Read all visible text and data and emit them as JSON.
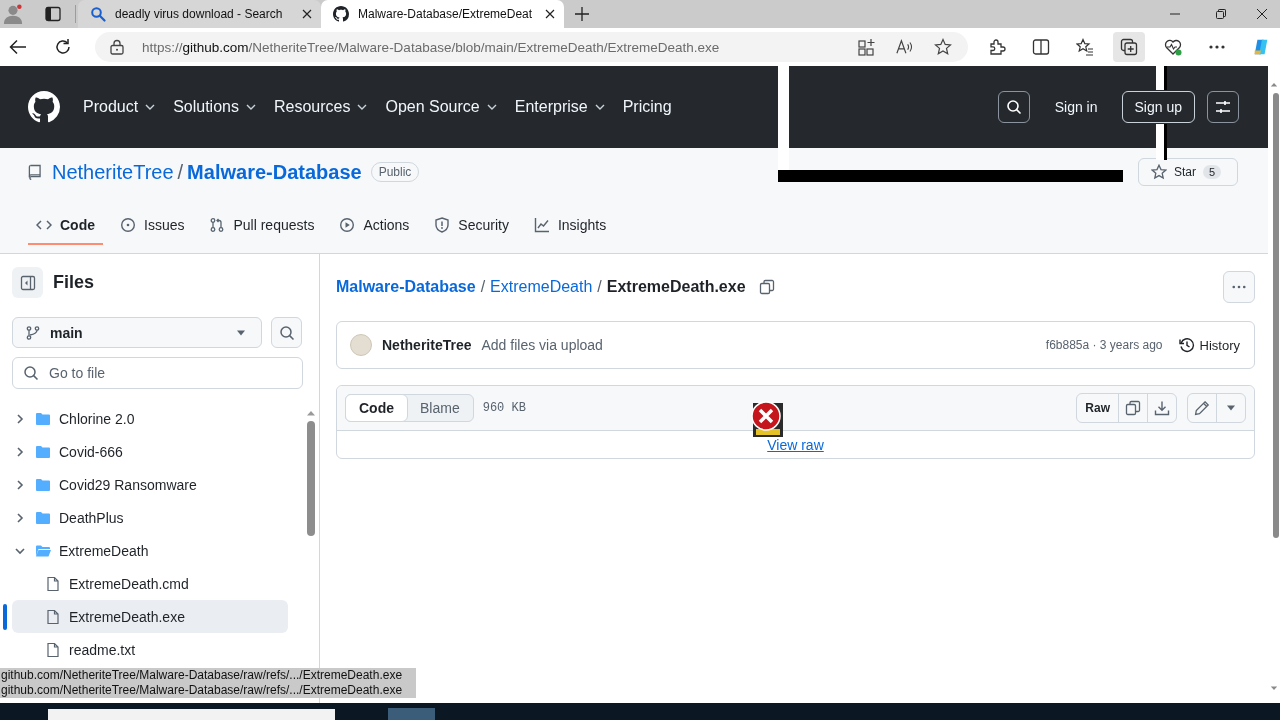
{
  "browser": {
    "tabs": [
      {
        "kind": "search",
        "title": "deadly virus download - Search",
        "selected": false
      },
      {
        "kind": "github",
        "title": "Malware-Database/ExtremeDeat",
        "selected": true
      }
    ],
    "address": {
      "scheme": "https://",
      "host": "github.com",
      "path": "/NetheriteTree/Malware-Database/blob/main/ExtremeDeath/ExtremeDeath.exe"
    }
  },
  "header": {
    "nav": [
      {
        "label": "Product",
        "kind": "menu"
      },
      {
        "label": "Solutions",
        "kind": "menu"
      },
      {
        "label": "Resources",
        "kind": "menu"
      },
      {
        "label": "Open Source",
        "kind": "menu"
      },
      {
        "label": "Enterprise",
        "kind": "menu"
      },
      {
        "label": "Pricing",
        "kind": "link"
      }
    ],
    "sign_in": "Sign in",
    "sign_up": "Sign up"
  },
  "repo": {
    "owner": "NetheriteTree",
    "separator": "/",
    "name": "Malware-Database",
    "visibility": "Public",
    "star": {
      "label": "Star",
      "count": "5"
    }
  },
  "repo_tabs": [
    {
      "kind": "code",
      "label": "Code",
      "selected": true
    },
    {
      "kind": "issues",
      "label": "Issues",
      "selected": false
    },
    {
      "kind": "pulls",
      "label": "Pull requests",
      "selected": false
    },
    {
      "kind": "actions",
      "label": "Actions",
      "selected": false
    },
    {
      "kind": "security",
      "label": "Security",
      "selected": false
    },
    {
      "kind": "insights",
      "label": "Insights",
      "selected": false
    }
  ],
  "sidebar": {
    "title": "Files",
    "branch": "main",
    "search_placeholder": "Go to file",
    "tree": [
      {
        "kind": "folder",
        "name": "Chlorine 2.0",
        "expanded": false,
        "selected": false
      },
      {
        "kind": "folder",
        "name": "Covid-666",
        "expanded": false,
        "selected": false
      },
      {
        "kind": "folder",
        "name": "Covid29 Ransomware",
        "expanded": false,
        "selected": false
      },
      {
        "kind": "folder",
        "name": "DeathPlus",
        "expanded": false,
        "selected": false
      },
      {
        "kind": "folder",
        "name": "ExtremeDeath",
        "expanded": true,
        "selected": false,
        "children": [
          {
            "kind": "file",
            "name": "ExtremeDeath.cmd",
            "selected": false
          },
          {
            "kind": "file",
            "name": "ExtremeDeath.exe",
            "selected": true
          },
          {
            "kind": "file",
            "name": "readme.txt",
            "selected": false
          }
        ]
      }
    ]
  },
  "file_view": {
    "breadcrumb": [
      {
        "kind": "root",
        "label": "Malware-Database"
      },
      {
        "kind": "separator",
        "label": "/"
      },
      {
        "kind": "dir",
        "label": "ExtremeDeath"
      },
      {
        "kind": "separator",
        "label": "/"
      },
      {
        "kind": "current",
        "label": "ExtremeDeath.exe"
      }
    ],
    "commit": {
      "author": "NetheriteTree",
      "message": "Add files via upload",
      "meta": "f6b885a · 3 years ago",
      "history": "History"
    },
    "modes": [
      {
        "label": "Code",
        "selected": true
      },
      {
        "label": "Blame",
        "selected": false
      }
    ],
    "size": "960 KB",
    "raw": "Raw",
    "view_raw": "View raw"
  },
  "status_links": [
    "github.com/NetheriteTree/Malware-Database/raw/refs/.../ExtremeDeath.exe",
    "github.com/NetheriteTree/Malware-Database/raw/refs/.../ExtremeDeath.exe"
  ]
}
